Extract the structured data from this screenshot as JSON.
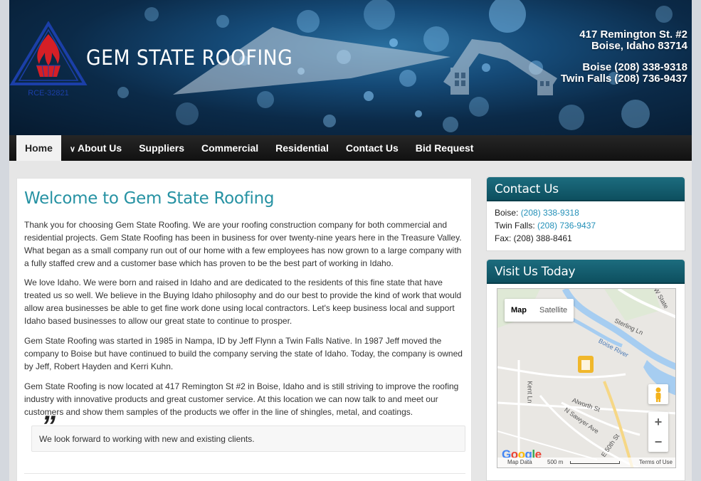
{
  "header": {
    "logo_text": "RCE-32821",
    "brand": "GEM STATE ROOFING",
    "address_line1": "417 Remington St. #2",
    "address_line2": "Boise, Idaho 83714",
    "phone_boise": "Boise (208) 338-9318",
    "phone_twinfalls": "Twin Falls (208) 736-9437"
  },
  "nav": {
    "items": [
      {
        "label": "Home",
        "active": true
      },
      {
        "label": "About Us",
        "has_dropdown": true
      },
      {
        "label": "Suppliers"
      },
      {
        "label": "Commercial"
      },
      {
        "label": "Residential"
      },
      {
        "label": "Contact Us"
      },
      {
        "label": "Bid Request"
      }
    ]
  },
  "main": {
    "title": "Welcome to Gem State Roofing",
    "paragraphs": [
      "Thank you for choosing Gem State Roofing.  We are your roofing construction company for both commercial and residential projects. Gem State Roofing has been in business for over twenty-nine years here in the Treasure Valley. What began as a small company run out of our home with a few employees has now grown to a large company with a fully staffed crew and a customer base which has proven to be the best part of working in Idaho.",
      "We love Idaho. We were born and raised in Idaho and are dedicated to the residents of this fine state that have treated us so well. We believe in the Buying Idaho philosophy and do our best to provide the kind of work that would allow area businesses be able to get fine work done using local contractors. Let's keep business local and support Idaho based businesses to allow our great state to continue to prosper.",
      "Gem State Roofing was started in 1985 in Nampa, ID by Jeff Flynn a Twin Falls Native.  In 1987 Jeff moved the company to Boise but have continued to build the company serving the state of Idaho. Today, the company is owned by Jeff, Robert Hayden and Kerri Kuhn.",
      "Gem State Roofing is now located at 417 Remington St #2 in Boise, Idaho and is still striving to improve the roofing industry with innovative products and great customer service.  At this location we can now talk to and meet our customers and show them samples of the products we offer in the line of shingles, metal, and coatings."
    ],
    "quote": "We look forward to working with new and existing clients."
  },
  "contact": {
    "title": "Contact Us",
    "boise_label": "Boise: ",
    "boise_phone": "(208) 338-9318",
    "twinfalls_label": "Twin Falls: ",
    "twinfalls_phone": "(208) 736-9437",
    "fax": "Fax: (208) 388-8461"
  },
  "visit": {
    "title": "Visit Us Today",
    "map": {
      "tab_map": "Map",
      "tab_satellite": "Satellite",
      "zoom_in": "+",
      "zoom_out": "−",
      "map_data": "Map Data",
      "scale": "500 m",
      "terms": "Terms of Use",
      "google": "Google",
      "labels": {
        "w_state": "W State",
        "sterling": "Sterling Ln",
        "boise_river": "Boise River",
        "kent": "Kent Ln",
        "alworth": "Alworth St",
        "sawyer": "N Sawyer Ave",
        "e50th": "E 50th St"
      }
    }
  },
  "colors": {
    "accent": "#2692a3",
    "panel_header": "#0d4f5f",
    "nav_bg": "#1a1a1a",
    "link": "#2390b8"
  }
}
